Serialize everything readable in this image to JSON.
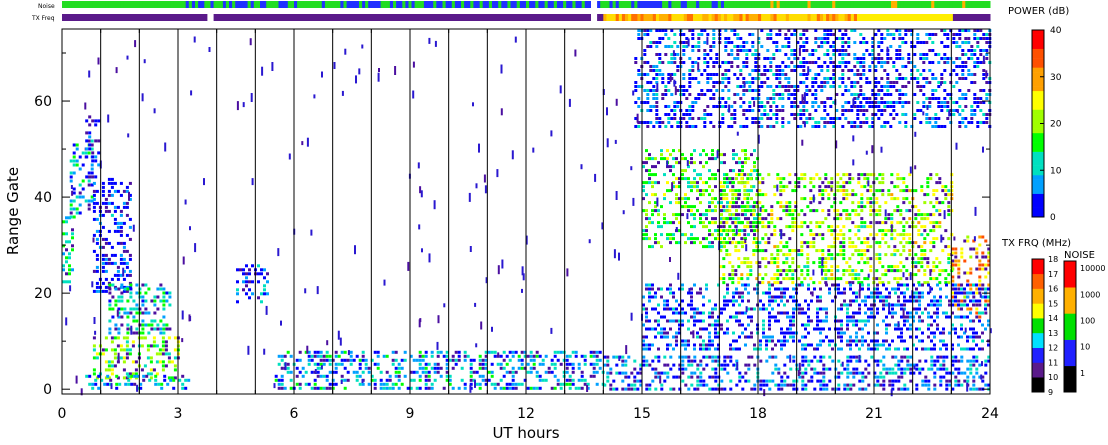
{
  "chart_data": {
    "type": "heatmap",
    "xlabel": "UT hours",
    "ylabel": "Range Gate",
    "xlim": [
      0,
      24
    ],
    "ylim": [
      -1,
      75
    ],
    "x_ticks": [
      "0",
      "3",
      "6",
      "9",
      "12",
      "15",
      "18",
      "21",
      "24"
    ],
    "x_tick_values": [
      0,
      3,
      6,
      9,
      12,
      15,
      18,
      21,
      24
    ],
    "y_ticks": [
      "0",
      "20",
      "40",
      "60"
    ],
    "y_tick_values": [
      0,
      20,
      40,
      60
    ],
    "vertical_lines_hours": [
      1,
      2,
      3,
      4,
      5,
      6,
      7,
      8,
      9,
      10,
      11,
      12,
      13,
      14,
      15,
      16,
      17,
      18,
      19,
      20,
      21,
      22,
      23
    ],
    "top_bars": {
      "noise_label": "Noise",
      "txfreq_label": "TX Freq"
    },
    "scatter_regions": [
      {
        "x0": 0.0,
        "x1": 0.25,
        "y0": 22,
        "y1": 36,
        "level": 0.3
      },
      {
        "x0": 0.2,
        "x1": 0.8,
        "y0": 36,
        "y1": 52,
        "level": 0.2
      },
      {
        "x0": 0.6,
        "x1": 0.95,
        "y0": 44,
        "y1": 57,
        "level": 0.05
      },
      {
        "x0": 0.8,
        "x1": 1.8,
        "y0": 20,
        "y1": 44,
        "level": 0.05
      },
      {
        "x0": 1.2,
        "x1": 2.8,
        "y0": 12,
        "y1": 22,
        "level": 0.25
      },
      {
        "x0": 0.8,
        "x1": 3.0,
        "y0": 2,
        "y1": 11,
        "level": 0.45
      },
      {
        "x0": 0.6,
        "x1": 3.3,
        "y0": 0,
        "y1": 3,
        "level": 0.2
      },
      {
        "x0": 4.5,
        "x1": 5.3,
        "y0": 18,
        "y1": 26,
        "level": 0.1
      },
      {
        "x0": 5.5,
        "x1": 14.0,
        "y0": 0,
        "y1": 8,
        "level": 0.2
      },
      {
        "x0": 14.0,
        "x1": 24.0,
        "y0": 0,
        "y1": 7,
        "level": 0.15
      },
      {
        "x0": 15.0,
        "x1": 18.0,
        "y0": 30,
        "y1": 50,
        "level": 0.4
      },
      {
        "x0": 17.0,
        "x1": 23.0,
        "y0": 22,
        "y1": 45,
        "level": 0.5
      },
      {
        "x0": 23.0,
        "x1": 24.0,
        "y0": 15,
        "y1": 32,
        "level": 0.7
      },
      {
        "x0": 14.8,
        "x1": 24.0,
        "y0": 55,
        "y1": 75,
        "level": 0.1
      },
      {
        "x0": 15.0,
        "x1": 24.0,
        "y0": 8,
        "y1": 22,
        "level": 0.1
      }
    ],
    "power_colorbar": {
      "title": "POWER (dB)",
      "ticks": [
        "0",
        "10",
        "20",
        "30",
        "40"
      ],
      "tick_values": [
        0,
        10,
        20,
        30,
        40
      ],
      "colors": [
        "#0000ff",
        "#00a0ff",
        "#00e0c0",
        "#00ff00",
        "#a0ff00",
        "#ffff00",
        "#ffa000",
        "#ff5000",
        "#ff0000"
      ]
    },
    "txfreq_colorbar": {
      "title": "TX FRQ (MHz)",
      "ticks": [
        "9",
        "10",
        "11",
        "12",
        "13",
        "14",
        "15",
        "16",
        "17",
        "18"
      ],
      "tick_values": [
        9,
        10,
        11,
        12,
        13,
        14,
        15,
        16,
        17,
        18
      ],
      "colors": [
        "#000000",
        "#5a1a8a",
        "#2020ff",
        "#00e0ff",
        "#00e000",
        "#ffff00",
        "#ffb000",
        "#ff6000",
        "#ff0000"
      ]
    },
    "noise_colorbar": {
      "title": "NOISE",
      "ticks": [
        "1",
        "10",
        "100",
        "1000",
        "10000"
      ],
      "tick_values": [
        1,
        10,
        100,
        1000,
        10000
      ],
      "colors": [
        "#000000",
        "#2020ff",
        "#00e000",
        "#ffb000",
        "#ff0000"
      ]
    }
  }
}
